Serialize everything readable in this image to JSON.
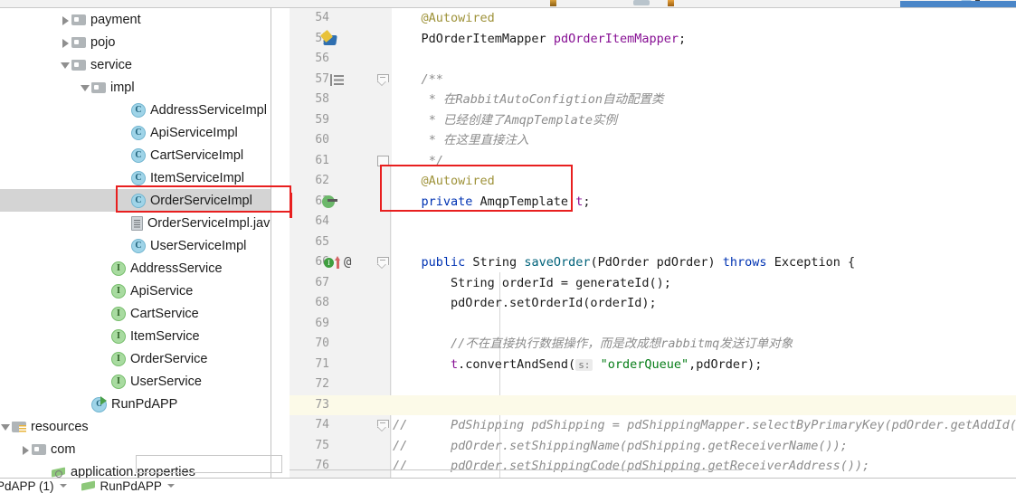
{
  "app": {
    "accent_blue": "#4a86c8",
    "highlight_red": "#e81f1f",
    "selection_gray": "#d4d4d4",
    "current_line_yellow": "#fcfae8"
  },
  "sidebar": {
    "name": "project-tree",
    "items": [
      {
        "label": "payment",
        "icon": "folder-icon",
        "arrow": "closed",
        "indent": 66,
        "type": "folder"
      },
      {
        "label": "pojo",
        "icon": "folder-icon",
        "arrow": "closed",
        "indent": 66,
        "type": "folder"
      },
      {
        "label": "service",
        "icon": "folder-icon",
        "arrow": "open",
        "indent": 66,
        "type": "folder"
      },
      {
        "label": "impl",
        "icon": "folder-icon",
        "arrow": "open",
        "indent": 88,
        "type": "folder"
      },
      {
        "label": "AddressServiceImpl",
        "icon": "java-class-icon",
        "arrow": "none",
        "indent": 132,
        "type": "class"
      },
      {
        "label": "ApiServiceImpl",
        "icon": "java-class-icon",
        "arrow": "none",
        "indent": 132,
        "type": "class"
      },
      {
        "label": "CartServiceImpl",
        "icon": "java-class-icon",
        "arrow": "none",
        "indent": 132,
        "type": "class"
      },
      {
        "label": "ItemServiceImpl",
        "icon": "java-class-icon",
        "arrow": "none",
        "indent": 132,
        "type": "class"
      },
      {
        "label": "OrderServiceImpl",
        "icon": "java-class-icon",
        "arrow": "none",
        "indent": 132,
        "type": "class",
        "selected": true,
        "highlighted": true
      },
      {
        "label": "OrderServiceImpl.jav",
        "icon": "java-file-icon",
        "arrow": "none",
        "indent": 132,
        "type": "file"
      },
      {
        "label": "UserServiceImpl",
        "icon": "java-class-icon",
        "arrow": "none",
        "indent": 132,
        "type": "class"
      },
      {
        "label": "AddressService",
        "icon": "java-interface-icon",
        "arrow": "none",
        "indent": 110,
        "type": "interface"
      },
      {
        "label": "ApiService",
        "icon": "java-interface-icon",
        "arrow": "none",
        "indent": 110,
        "type": "interface"
      },
      {
        "label": "CartService",
        "icon": "java-interface-icon",
        "arrow": "none",
        "indent": 110,
        "type": "interface"
      },
      {
        "label": "ItemService",
        "icon": "java-interface-icon",
        "arrow": "none",
        "indent": 110,
        "type": "interface"
      },
      {
        "label": "OrderService",
        "icon": "java-interface-icon",
        "arrow": "none",
        "indent": 110,
        "type": "interface"
      },
      {
        "label": "UserService",
        "icon": "java-interface-icon",
        "arrow": "none",
        "indent": 110,
        "type": "interface"
      },
      {
        "label": "RunPdAPP",
        "icon": "runnable-class-icon",
        "arrow": "none",
        "indent": 88,
        "type": "runnable"
      },
      {
        "label": "resources",
        "icon": "resources-folder-icon",
        "arrow": "open",
        "indent": 0,
        "type": "folder"
      },
      {
        "label": "com",
        "icon": "folder-icon",
        "arrow": "closed",
        "indent": 22,
        "type": "folder"
      },
      {
        "label": "application.properties",
        "icon": "properties-file-icon",
        "arrow": "none",
        "indent": 44,
        "type": "file"
      }
    ]
  },
  "editor": {
    "name": "code-editor",
    "first_line": 54,
    "current_line": 73,
    "lines": [
      {
        "num": 54,
        "indent": 4,
        "tokens": [
          {
            "t": "@Autowired",
            "c": "t-ann"
          }
        ]
      },
      {
        "num": 55,
        "indent": 4,
        "gutter": "spring-bean-icon",
        "tokens": [
          {
            "t": "PdOrderItemMapper ",
            "c": "t-type"
          },
          {
            "t": "pdOrderItemMapper",
            "c": "t-field"
          },
          {
            "t": ";",
            "c": "t-plain"
          }
        ]
      },
      {
        "num": 56,
        "indent": 0,
        "tokens": []
      },
      {
        "num": 57,
        "indent": 4,
        "gutter": "structure-icon",
        "fold": "fold-start",
        "tokens": [
          {
            "t": "/**",
            "c": "t-com"
          }
        ]
      },
      {
        "num": 58,
        "indent": 5,
        "tokens": [
          {
            "t": "* 在RabbitAutoConfigtion自动配置类",
            "c": "t-com"
          }
        ]
      },
      {
        "num": 59,
        "indent": 5,
        "tokens": [
          {
            "t": "* 已经创建了AmqpTemplate实例",
            "c": "t-com"
          }
        ]
      },
      {
        "num": 60,
        "indent": 5,
        "tokens": [
          {
            "t": "* 在这里直接注入",
            "c": "t-com"
          }
        ]
      },
      {
        "num": 61,
        "indent": 5,
        "fold": "fold-end",
        "tokens": [
          {
            "t": "*/",
            "c": "t-com"
          }
        ]
      },
      {
        "num": 62,
        "indent": 4,
        "tokens": [
          {
            "t": "@Autowired",
            "c": "t-ann"
          }
        ]
      },
      {
        "num": 63,
        "indent": 4,
        "gutter": "bean-autowire-icon",
        "tokens": [
          {
            "t": "private ",
            "c": "t-kw"
          },
          {
            "t": "AmqpTemplate ",
            "c": "t-type"
          },
          {
            "t": "t",
            "c": "t-field"
          },
          {
            "t": ";",
            "c": "t-plain"
          }
        ]
      },
      {
        "num": 64,
        "indent": 0,
        "tokens": []
      },
      {
        "num": 65,
        "indent": 0,
        "tokens": []
      },
      {
        "num": 66,
        "indent": 4,
        "gutter": "implements-at-icon",
        "fold": "fold-start",
        "tokens": [
          {
            "t": "public ",
            "c": "t-kw"
          },
          {
            "t": "String ",
            "c": "t-type"
          },
          {
            "t": "saveOrder",
            "c": "t-meth"
          },
          {
            "t": "(PdOrder pdOrder) ",
            "c": "t-plain"
          },
          {
            "t": "throws ",
            "c": "t-kw"
          },
          {
            "t": "Exception {",
            "c": "t-plain"
          }
        ]
      },
      {
        "num": 67,
        "indent": 8,
        "tokens": [
          {
            "t": "String orderId = generateId();",
            "c": "t-plain"
          }
        ]
      },
      {
        "num": 68,
        "indent": 8,
        "tokens": [
          {
            "t": "pdOrder.setOrderId(orderId);",
            "c": "t-plain"
          }
        ]
      },
      {
        "num": 69,
        "indent": 0,
        "tokens": []
      },
      {
        "num": 70,
        "indent": 8,
        "tokens": [
          {
            "t": "//不在直接执行数据操作，而是改成想rabbitmq发送订单对象",
            "c": "t-com"
          }
        ]
      },
      {
        "num": 71,
        "indent": 8,
        "tokens": [
          {
            "t": "t",
            "c": "t-field"
          },
          {
            "t": ".convertAndSend(",
            "c": "t-plain"
          },
          {
            "t": " s: ",
            "c": "hint"
          },
          {
            "t": "\"orderQueue\"",
            "c": "t-str"
          },
          {
            "t": ",pdOrder);",
            "c": "t-plain"
          }
        ]
      },
      {
        "num": 72,
        "indent": 0,
        "tokens": []
      },
      {
        "num": 73,
        "indent": 0,
        "current": true,
        "tokens": []
      },
      {
        "num": 74,
        "indent": 8,
        "prefix": "//",
        "fold": "fold-start",
        "tokens": [
          {
            "t": "PdShipping pdShipping = pdShippingMapper.selectByPrimaryKey(pdOrder.getAddId());",
            "c": "t-com"
          }
        ]
      },
      {
        "num": 75,
        "indent": 8,
        "prefix": "//",
        "tokens": [
          {
            "t": "pdOrder.setShippingName(pdShipping.getReceiverName());",
            "c": "t-com"
          }
        ]
      },
      {
        "num": 76,
        "indent": 8,
        "prefix": "//",
        "tokens": [
          {
            "t": "pdOrder.setShippingCode(pdShipping.getReceiverAddress());",
            "c": "t-com"
          }
        ]
      }
    ]
  },
  "statusbar": {
    "name": "run-status-bar",
    "items": [
      {
        "label": "PdAPP (1)",
        "icon": "none",
        "chevron": true
      },
      {
        "label": "RunPdAPP",
        "icon": "run-config-icon",
        "chevron": true
      }
    ]
  }
}
